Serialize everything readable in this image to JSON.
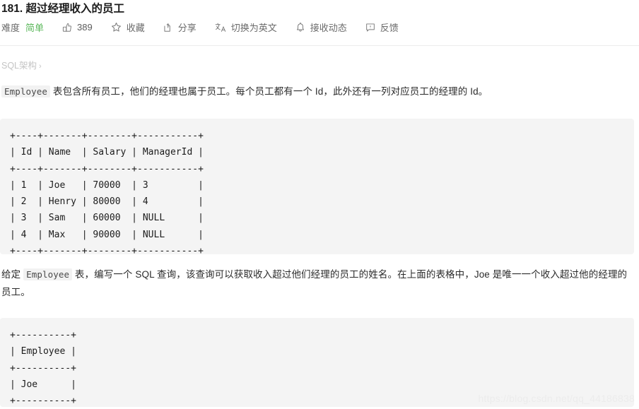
{
  "problem": {
    "title": "181. 超过经理收入的员工"
  },
  "toolbar": {
    "difficulty_label": "难度",
    "difficulty_value": "简单",
    "likes_count": "389",
    "favorite_label": "收藏",
    "share_label": "分享",
    "translate_label": "切换为英文",
    "subscribe_label": "接收动态",
    "feedback_label": "反馈",
    "icons": {
      "like": "thumbs-up-icon",
      "favorite": "star-icon",
      "share": "share-icon",
      "translate": "translate-icon",
      "subscribe": "bell-icon",
      "feedback": "comment-alert-icon"
    }
  },
  "breadcrumb": {
    "label": "SQL架构",
    "chevron": "›"
  },
  "content": {
    "paragraph_1_pre": "",
    "paragraph_1_code": "Employee",
    "paragraph_1_post": " 表包含所有员工，他们的经理也属于员工。每个员工都有一个 Id，此外还有一列对应员工的经理的 Id。",
    "paragraph_2_pre": "给定 ",
    "paragraph_2_code": "Employee",
    "paragraph_2_post": " 表，编写一个 SQL 查询，该查询可以获取收入超过他们经理的员工的姓名。在上面的表格中，Joe 是唯一一个收入超过他的经理的员工。",
    "code_block_1": "+----+-------+--------+-----------+\n| Id | Name  | Salary | ManagerId |\n+----+-------+--------+-----------+\n| 1  | Joe   | 70000  | 3         |\n| 2  | Henry | 80000  | 4         |\n| 3  | Sam   | 60000  | NULL      |\n| 4  | Max   | 90000  | NULL      |\n+----+-------+--------+-----------+",
    "code_block_2": "+----------+\n| Employee |\n+----------+\n| Joe      |\n+----------+"
  },
  "table_data": {
    "columns": [
      "Id",
      "Name",
      "Salary",
      "ManagerId"
    ],
    "rows": [
      [
        "1",
        "Joe",
        "70000",
        "3"
      ],
      [
        "2",
        "Henry",
        "80000",
        "4"
      ],
      [
        "3",
        "Sam",
        "60000",
        "NULL"
      ],
      [
        "4",
        "Max",
        "90000",
        "NULL"
      ]
    ],
    "result_columns": [
      "Employee"
    ],
    "result_rows": [
      [
        "Joe"
      ]
    ]
  },
  "watermark": {
    "text": "https://blog.csdn.net/qq_44186838"
  },
  "colors": {
    "difficulty_easy": "#5cb85c",
    "code_bg": "#f4f4f4",
    "divider": "#ececec",
    "watermark": "#ececec"
  }
}
